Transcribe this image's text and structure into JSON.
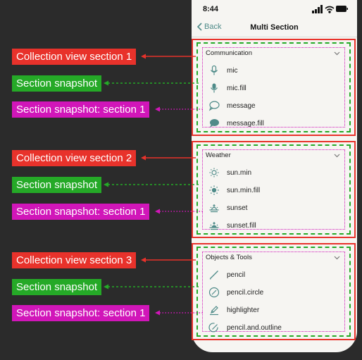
{
  "annotations": {
    "section1": {
      "collection": "Collection view section 1",
      "snapshot": "Section snapshot",
      "snapshot_section": "Section snapshot: section 1"
    },
    "section2": {
      "collection": "Collection view section 2",
      "snapshot": "Section snapshot",
      "snapshot_section": "Section snapshot: section 1"
    },
    "section3": {
      "collection": "Collection view section 3",
      "snapshot": "Section snapshot",
      "snapshot_section": "Section snapshot: section 1"
    }
  },
  "phone": {
    "time": "8:44",
    "back": "Back",
    "title": "Multi Section"
  },
  "sections": [
    {
      "title": "Communication",
      "items": [
        "mic",
        "mic.fill",
        "message",
        "message.fill"
      ]
    },
    {
      "title": "Weather",
      "items": [
        "sun.min",
        "sun.min.fill",
        "sunset",
        "sunset.fill"
      ]
    },
    {
      "title": "Objects & Tools",
      "items": [
        "pencil",
        "pencil.circle",
        "highlighter",
        "pencil.and.outline"
      ]
    }
  ],
  "colors": {
    "collection": "#e8322b",
    "snapshot": "#25a927",
    "snapshot_section": "#d116b9",
    "icon": "#4f8b89"
  }
}
